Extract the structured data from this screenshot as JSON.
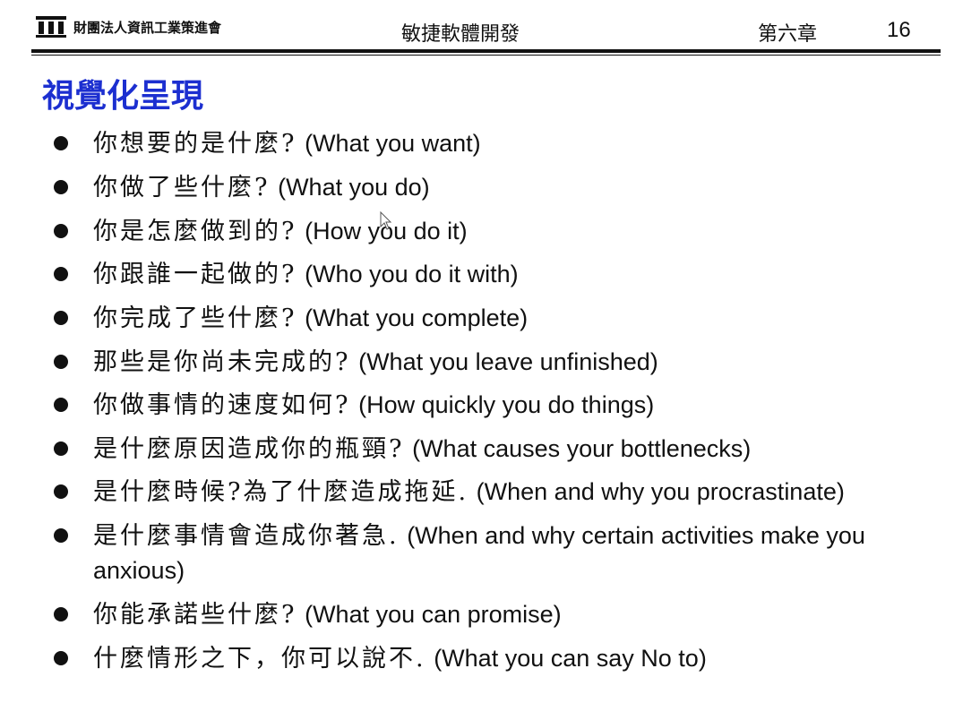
{
  "header": {
    "org_name": "財團法人資訊工業策進會",
    "course_title": "敏捷軟體開發",
    "chapter": "第六章",
    "page_number": "16"
  },
  "slide": {
    "title": "視覺化呈現",
    "title_color": "#1c2fd0",
    "bullets": [
      {
        "zh": "你想要的是什麼?",
        "en": "(What you want)"
      },
      {
        "zh": "你做了些什麼?",
        "en": "(What you do)"
      },
      {
        "zh": "你是怎麼做到的?",
        "en": "(How you do it)"
      },
      {
        "zh": "你跟誰一起做的?",
        "en": "(Who you do it with)"
      },
      {
        "zh": "你完成了些什麼?",
        "en": "(What you complete)"
      },
      {
        "zh": "那些是你尚未完成的?",
        "en": "(What you leave unfinished)"
      },
      {
        "zh": "你做事情的速度如何?",
        "en": "(How quickly you do things)"
      },
      {
        "zh": "是什麼原因造成你的瓶頸?",
        "en": "(What causes your bottlenecks)"
      },
      {
        "zh": "是什麼時候?為了什麼造成拖延.",
        "en": "(When and why you procrastinate)"
      },
      {
        "zh": "是什麼事情會造成你著急.",
        "en": "(When and why certain activities make you anxious)"
      },
      {
        "zh": "你能承諾些什麼?",
        "en": "(What you can promise)"
      },
      {
        "zh": "什麼情形之下，你可以說不.",
        "en": "(What you can say No to)"
      }
    ]
  }
}
